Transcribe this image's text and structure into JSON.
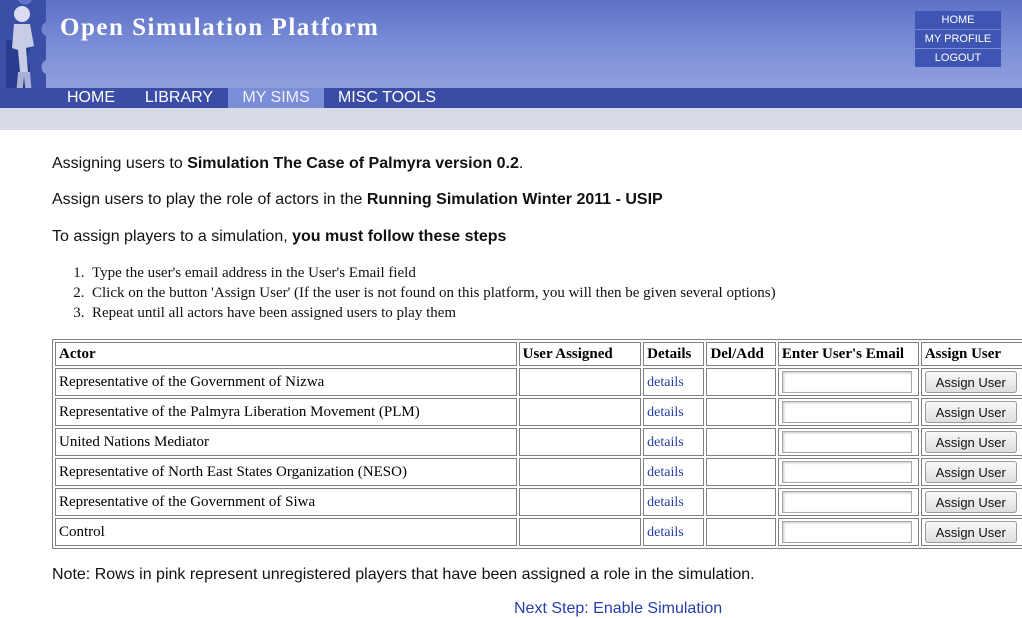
{
  "header": {
    "site_title": "Open Simulation Platform",
    "top_links": [
      "HOME",
      "MY PROFILE",
      "LOGOUT"
    ]
  },
  "nav": {
    "tabs": [
      {
        "label": "HOME",
        "active": false
      },
      {
        "label": "LIBRARY",
        "active": false
      },
      {
        "label": "MY SIMS",
        "active": true
      },
      {
        "label": "MISC TOOLS",
        "active": false
      }
    ]
  },
  "intro": {
    "line1_prefix": "Assigning users to ",
    "line1_bold": "Simulation The Case of Palmyra version 0.2",
    "line1_suffix": ".",
    "line2_prefix": "Assign users to play the role of actors in the ",
    "line2_bold": "Running Simulation Winter 2011 - USIP",
    "line3_prefix": "To assign players to a simulation, ",
    "line3_bold": "you must follow these steps"
  },
  "steps": [
    "Type the user's email address in the User's Email field",
    "Click on the button 'Assign User' (If the user is not found on this platform, you will then be given several options)",
    "Repeat until all actors have been assigned users to play them"
  ],
  "table": {
    "headers": [
      "Actor",
      "User Assigned",
      "Details",
      "Del/Add",
      "Enter User's Email",
      "Assign User"
    ],
    "details_label": "details",
    "button_label": "Assign User",
    "rows": [
      {
        "actor": "Representative of the Government of Nizwa",
        "user_assigned": "",
        "email": ""
      },
      {
        "actor": "Representative of the Palmyra Liberation Movement (PLM)",
        "user_assigned": "",
        "email": ""
      },
      {
        "actor": "United Nations Mediator",
        "user_assigned": "",
        "email": ""
      },
      {
        "actor": "Representative of North East States Organization (NESO)",
        "user_assigned": "",
        "email": ""
      },
      {
        "actor": "Representative of the Government of Siwa",
        "user_assigned": "",
        "email": ""
      },
      {
        "actor": "Control",
        "user_assigned": "",
        "email": ""
      }
    ]
  },
  "note": "Note: Rows in pink represent unregistered players that have been assigned a role in the simulation.",
  "next_step_label": "Next Step: Enable Simulation",
  "colors": {
    "header_blue": "#5d71c8",
    "nav_blue": "#3a4ca6",
    "active_tab": "#7b8dd6",
    "link_blue": "#2540a8",
    "subbar_gray": "#d7dbe8"
  }
}
